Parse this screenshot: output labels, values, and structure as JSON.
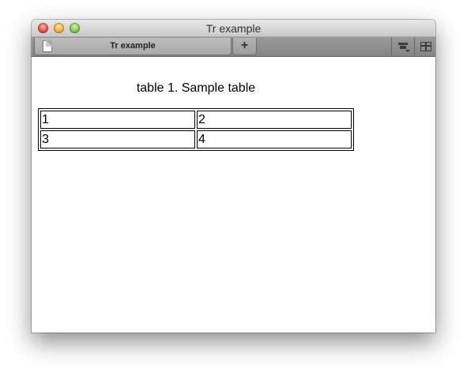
{
  "window": {
    "title": "Tr example"
  },
  "tabs": [
    {
      "label": "Tr example",
      "icon": "document-icon"
    }
  ],
  "toolbar": {
    "new_tab_label": "+",
    "downloads_icon": "download-icon",
    "layout_icon": "grid-icon"
  },
  "table": {
    "caption": "table 1. Sample table",
    "rows": [
      [
        "1",
        "2"
      ],
      [
        "3",
        "4"
      ]
    ]
  }
}
